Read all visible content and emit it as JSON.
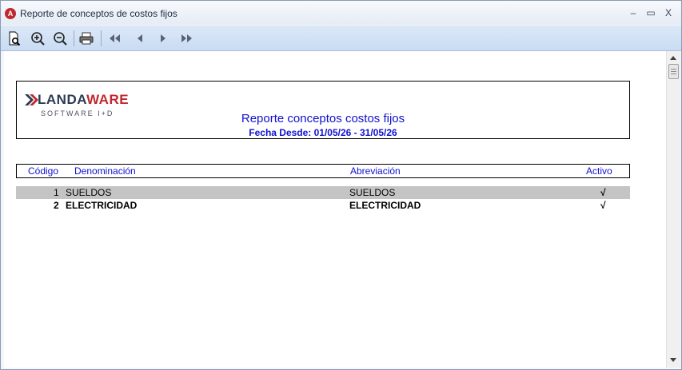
{
  "window": {
    "title": "Reporte de conceptos de costos fijos",
    "app_icon_letter": "A",
    "minimize_glyph": "–",
    "maximize_glyph": "▭",
    "close_glyph": "X"
  },
  "toolbar": {
    "buttons": [
      {
        "name": "preview-icon"
      },
      {
        "name": "zoom-in-icon"
      },
      {
        "name": "zoom-out-icon"
      },
      {
        "name": "print-icon"
      },
      {
        "name": "first-page-icon"
      },
      {
        "name": "previous-page-icon"
      },
      {
        "name": "next-page-icon"
      },
      {
        "name": "last-page-icon"
      }
    ]
  },
  "report": {
    "logo": {
      "part1": "LANDA",
      "part2": "WARE",
      "subtitle": "SOFTWARE I+D"
    },
    "title": "Reporte conceptos costos fijos",
    "date_range": "Fecha Desde: 01/05/26 - 31/05/26",
    "columns": {
      "code": "Código",
      "name": "Denominación",
      "abbr": "Abreviación",
      "active": "Activo"
    },
    "rows": [
      {
        "code": "1",
        "name": "SUELDOS",
        "abbr": "SUELDOS",
        "active": "√"
      },
      {
        "code": "2",
        "name": "ELECTRICIDAD",
        "abbr": "ELECTRICIDAD",
        "active": "√"
      }
    ]
  },
  "colors": {
    "report_blue": "#1010d0",
    "logo_red": "#c0282d",
    "logo_navy": "#2a3b54",
    "row_highlight": "#c4c4c4"
  }
}
